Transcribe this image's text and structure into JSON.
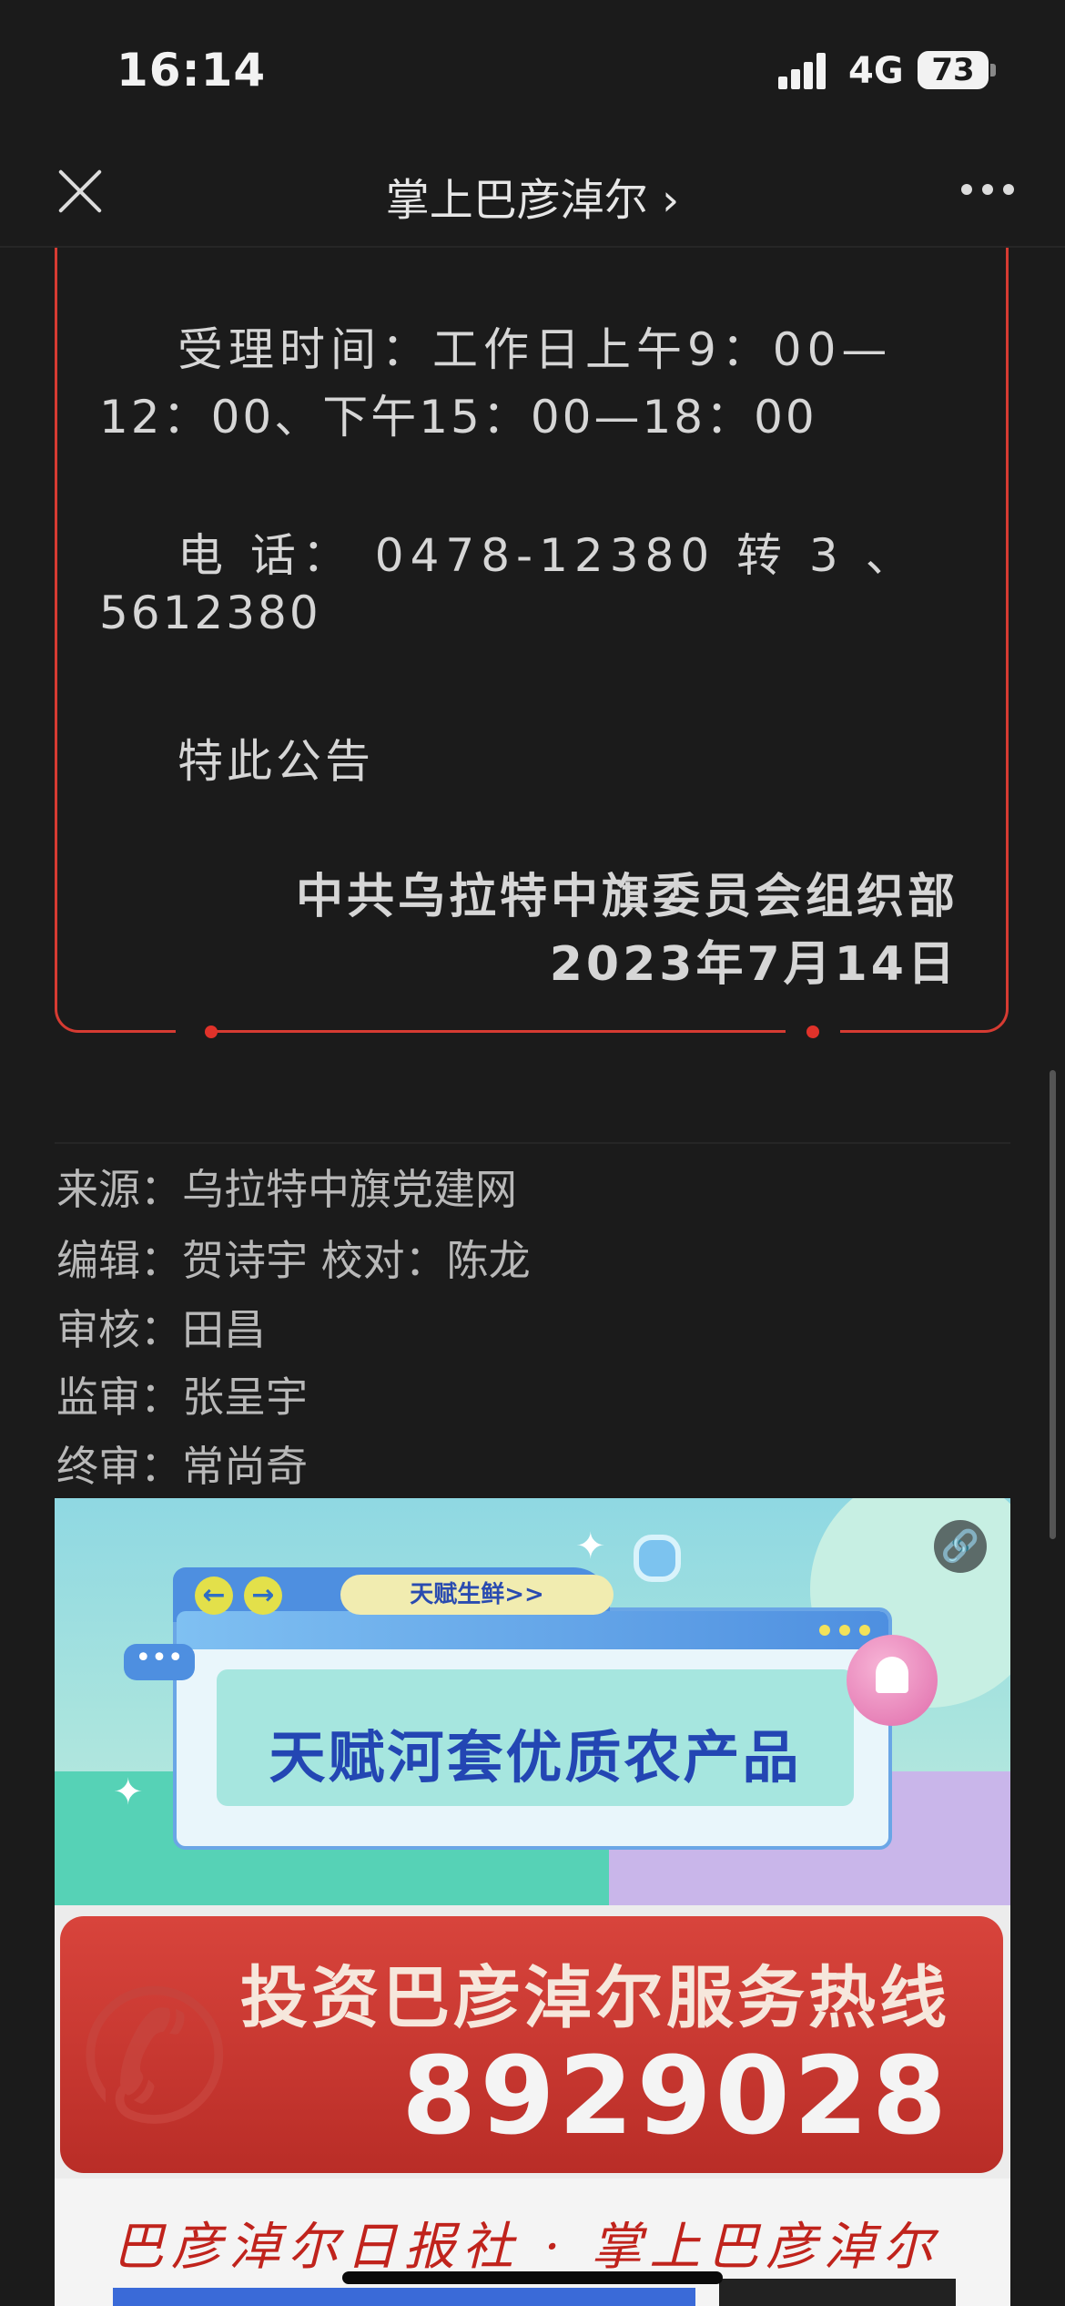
{
  "status_bar": {
    "time": "16:14",
    "network": "4G",
    "battery": "73"
  },
  "nav": {
    "title": "掌上巴彦淖尔 ›"
  },
  "notice": {
    "hours_line1": "受理时间：工作日上午9：00—",
    "hours_line2": "12：00、下午15：00—18：00",
    "phone_line1": "电  话：  0478-12380  转  3  、",
    "phone_line2": "5612380",
    "closing": "特此公告",
    "signature_org": "中共乌拉特中旗委员会组织部",
    "signature_date": "2023年7月14日"
  },
  "meta": {
    "source": "来源：乌拉特中旗党建网",
    "editor": "编辑：贺诗宇 校对：陈龙",
    "review": "审核：田昌",
    "supervisor": "监审：张呈宇",
    "final": "终审：常尚奇"
  },
  "banner_ad": {
    "pill_label": "天赋生鲜>>",
    "title": "天赋河套优质农产品",
    "chat_dots": "•••"
  },
  "hotline_ad": {
    "title": "投资巴彦淖尔服务热线",
    "number": "8929028",
    "footer_script": "巴彦淖尔日报社 · 掌上巴彦淖尔"
  },
  "colors": {
    "accent_red": "#d63b32",
    "background": "#1b1b1b"
  },
  "icons": [
    "close-icon",
    "more-icon",
    "link-icon",
    "bell-icon",
    "phone-icon"
  ]
}
